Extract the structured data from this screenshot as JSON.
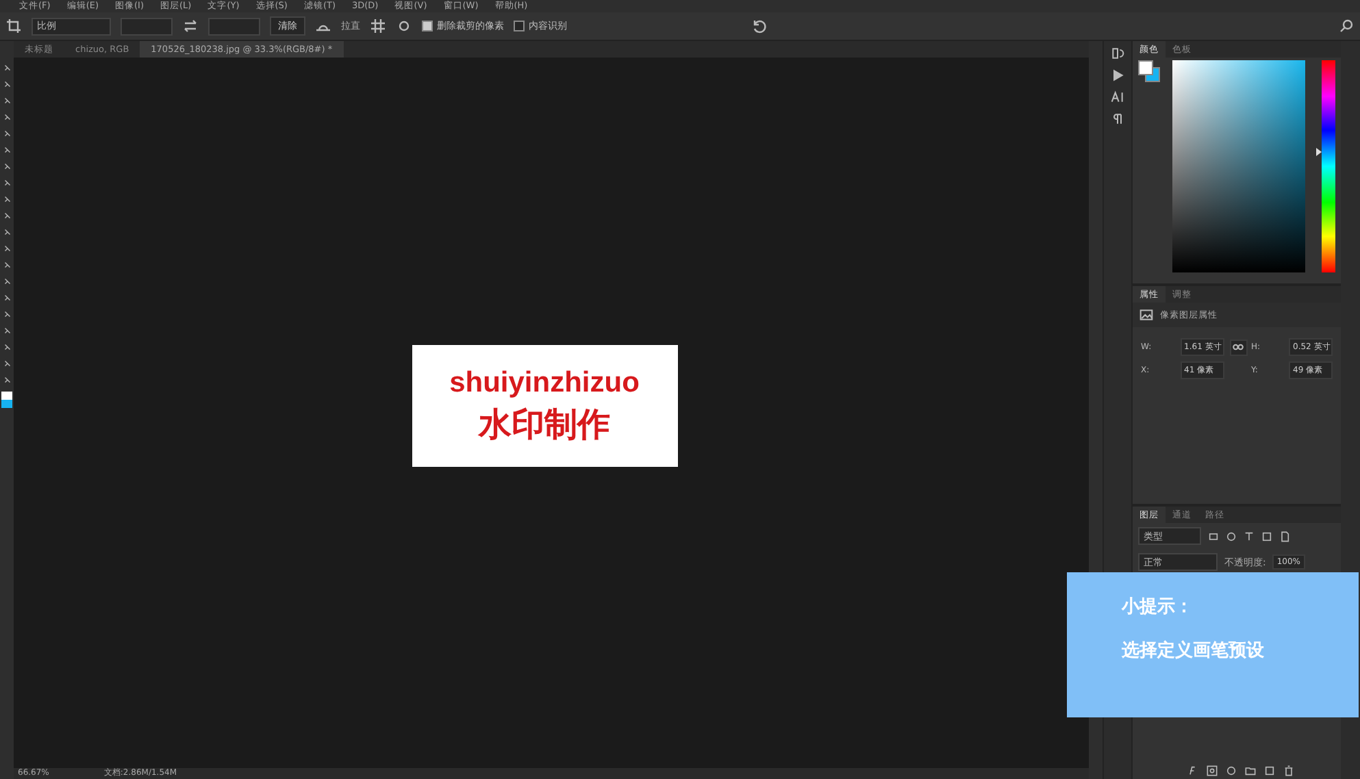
{
  "menu": [
    "文件(F)",
    "编辑(E)",
    "图像(I)",
    "图层(L)",
    "文字(Y)",
    "选择(S)",
    "滤镜(T)",
    "3D(D)",
    "视图(V)",
    "窗口(W)",
    "帮助(H)"
  ],
  "options": {
    "ratio": "比例",
    "clear": "清除",
    "straighten": "拉直",
    "checks": [
      {
        "label": "删除裁剪的像素",
        "checked": true
      },
      {
        "label": "内容识别",
        "checked": false
      }
    ]
  },
  "tabs": [
    {
      "label": "未标题",
      "selected": false
    },
    {
      "label": "chizuo, RGB",
      "selected": false
    },
    {
      "label": "170526_180238.jpg @ 33.3%(RGB/8#) *",
      "selected": true
    }
  ],
  "canvas": {
    "lines": [
      "shuiyinzhizuo",
      "水印制作"
    ]
  },
  "color_panel": {
    "tabs": [
      {
        "label": "颜色",
        "selected": true
      },
      {
        "label": "色板",
        "selected": false
      }
    ],
    "hue": {
      "level": 0.57
    }
  },
  "properties": {
    "tabs": [
      {
        "label": "属性",
        "selected": true
      },
      {
        "label": "调整",
        "selected": false
      }
    ],
    "title": "像素图层属性",
    "fields": [
      {
        "label": "W:",
        "value": "1.61 英寸"
      },
      {
        "label": "H:",
        "value": "0.52 英寸"
      },
      {
        "label": "X:",
        "value": "41 像素"
      },
      {
        "label": "Y:",
        "value": "49 像素"
      }
    ]
  },
  "layers": {
    "tabs": [
      {
        "label": "图层",
        "selected": true
      },
      {
        "label": "通道",
        "selected": false
      },
      {
        "label": "路径",
        "selected": false
      }
    ],
    "filter": "类型",
    "blend": "正常",
    "opacity_label": "不透明度:",
    "opacity": "100%"
  },
  "tip": {
    "title": "小提示：",
    "text": "选择定义画笔预设"
  },
  "status": {
    "zoom": "66.67%",
    "doc": "文档:2.86M/1.54M"
  }
}
